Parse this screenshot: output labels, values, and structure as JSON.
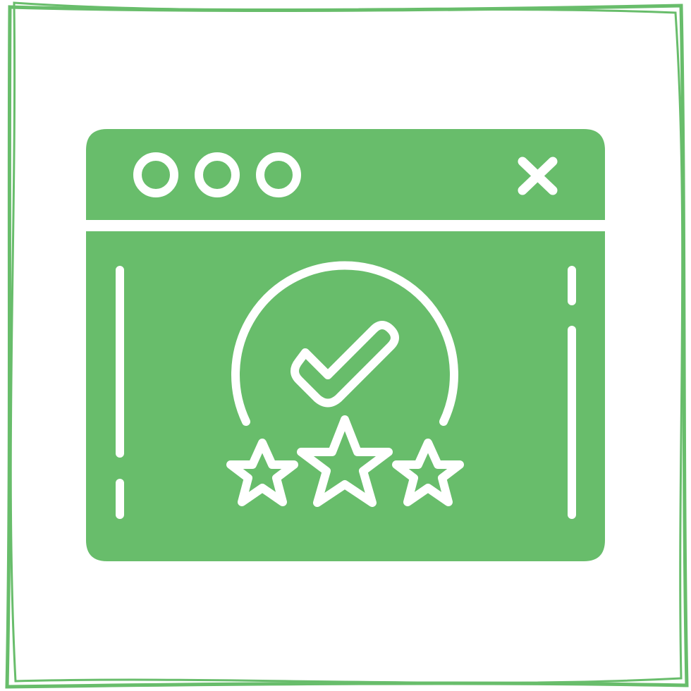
{
  "icon": {
    "name": "web-rating-approval",
    "accent_color": "#68bd6b",
    "foreground_color": "#ffffff",
    "background_color": "#ffffff",
    "window_dots_count": 3,
    "star_rating": 3,
    "star_max": 3,
    "icons": [
      "window-dot-icon",
      "close-icon",
      "check-icon",
      "star-icon"
    ]
  }
}
